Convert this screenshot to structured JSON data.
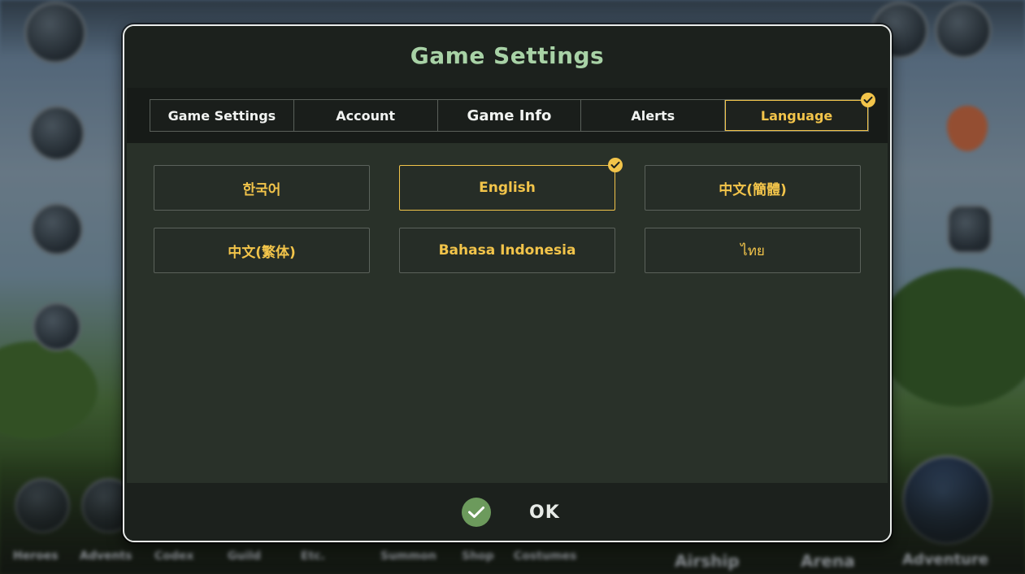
{
  "background": {
    "left_labels": [
      "Heroes",
      "Advents",
      "Codex",
      "Guild",
      "Etc.",
      "Summon",
      "Shop",
      "Costumes"
    ],
    "right_labels": [
      "Airship",
      "Arena",
      "Adventure"
    ]
  },
  "dialog": {
    "title": "Game Settings",
    "tabs": [
      {
        "label": "Game Settings",
        "active": false
      },
      {
        "label": "Account",
        "active": false
      },
      {
        "label": "Game Info",
        "active": false
      },
      {
        "label": "Alerts",
        "active": false
      },
      {
        "label": "Language",
        "active": true
      }
    ],
    "languages": [
      {
        "label": "한국어",
        "selected": false
      },
      {
        "label": "English",
        "selected": true
      },
      {
        "label": "中文(簡體)",
        "selected": false
      },
      {
        "label": "中文(繁体)",
        "selected": false
      },
      {
        "label": "Bahasa Indonesia",
        "selected": false
      },
      {
        "label": "ไทย",
        "selected": false
      }
    ],
    "ok_label": "OK"
  },
  "colors": {
    "accent": "#f2c44a",
    "title": "#a8d2a6",
    "panel": "#293129",
    "ok_icon": "#6c9a5c"
  },
  "icons": {
    "check_badge": "checkmark-icon",
    "ok": "checkmark-circle-icon"
  }
}
